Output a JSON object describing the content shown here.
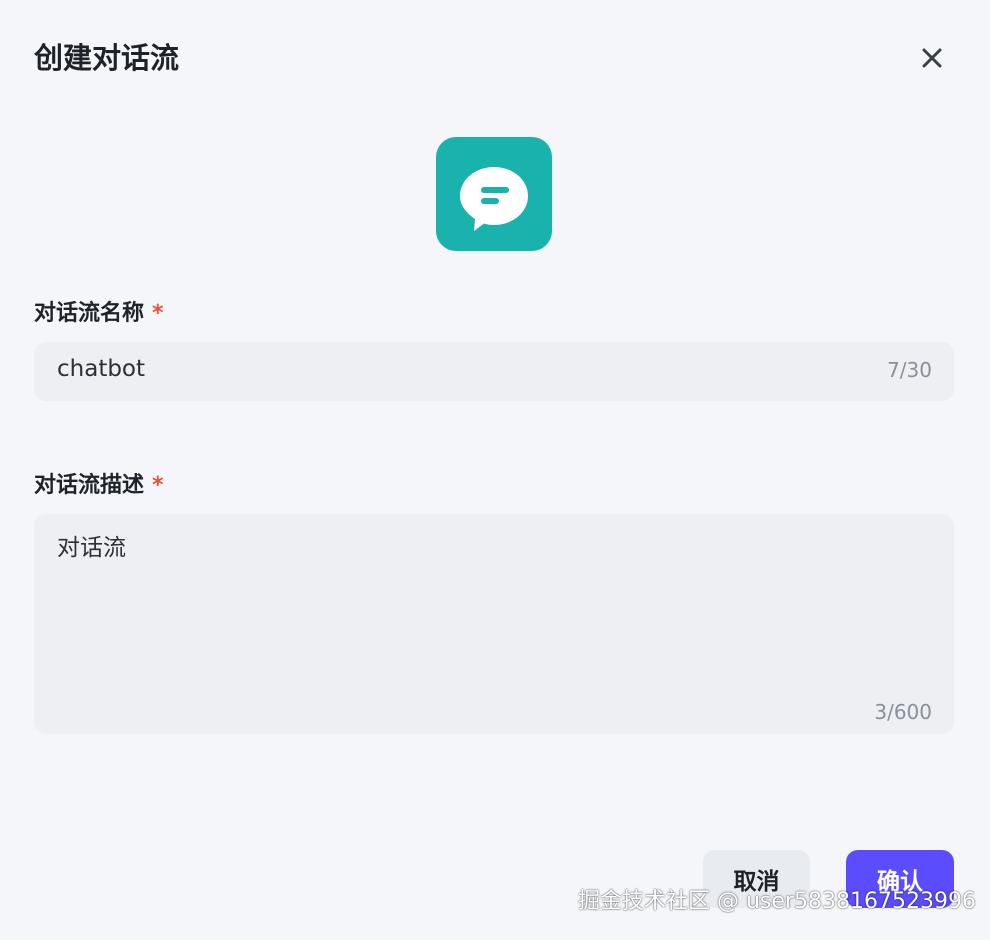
{
  "dialog": {
    "title": "创建对话流",
    "close_icon": "close-icon"
  },
  "app_icon": {
    "icon": "chat-bubble-icon",
    "color": "#1ab2ad"
  },
  "name_field": {
    "label": "对话流名称",
    "required_mark": "*",
    "value": "chatbot",
    "counter": "7/30"
  },
  "description_field": {
    "label": "对话流描述",
    "required_mark": "*",
    "value": "对话流",
    "counter": "3/600"
  },
  "actions": {
    "cancel_label": "取消",
    "confirm_label": "确认",
    "confirm_color": "#5b4cfd"
  },
  "watermark": "掘金技术社区 @ user5838167523996"
}
